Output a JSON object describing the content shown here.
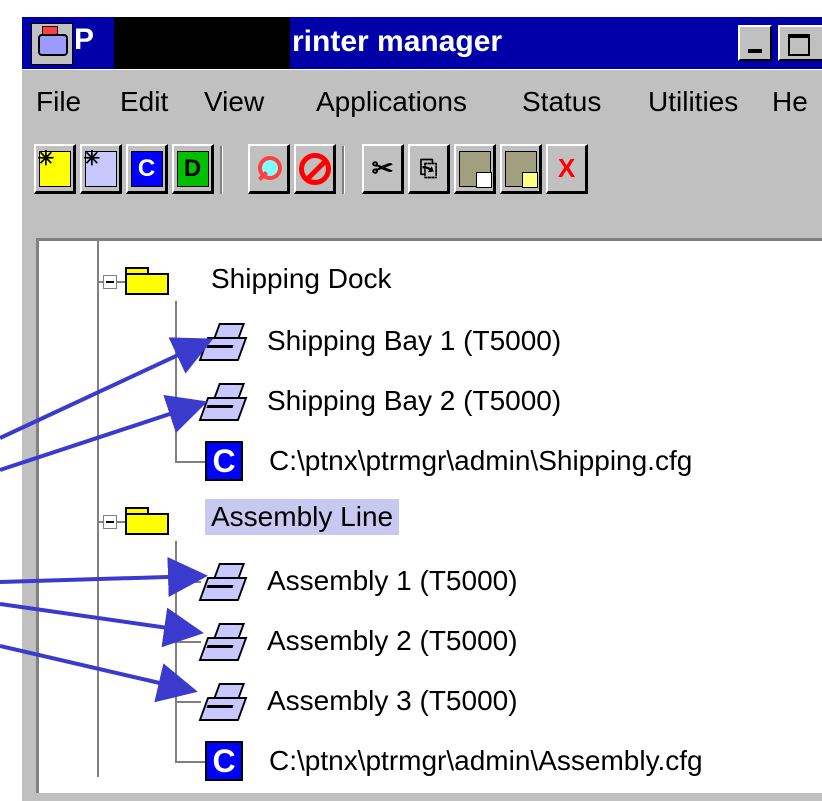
{
  "window": {
    "title_prefix": "P",
    "title": "rinter manager",
    "minimize_label": "",
    "maximize_label": ""
  },
  "menu": {
    "items": [
      "File",
      "Edit",
      "View",
      "Applications",
      "Status",
      "Utilities",
      "He"
    ]
  },
  "toolbar": {
    "buttons": [
      {
        "icon": "new-folder-icon",
        "label": ""
      },
      {
        "icon": "new-printer-icon",
        "label": ""
      },
      {
        "icon": "new-config-icon",
        "label": "C"
      },
      {
        "icon": "new-driver-icon",
        "label": "D"
      },
      {
        "icon": "search-icon",
        "label": ""
      },
      {
        "icon": "stop-icon",
        "label": ""
      },
      {
        "icon": "cut-icon",
        "label": "✂"
      },
      {
        "icon": "copy-icon",
        "label": "⎘"
      },
      {
        "icon": "paste-icon",
        "label": ""
      },
      {
        "icon": "paste-link-icon",
        "label": ""
      },
      {
        "icon": "delete-icon",
        "label": "X"
      }
    ]
  },
  "tree": {
    "groups": [
      {
        "name": "Shipping Dock",
        "selected": false,
        "children": [
          {
            "type": "printer",
            "label": "Shipping Bay 1 (T5000)"
          },
          {
            "type": "printer",
            "label": "Shipping Bay 2 (T5000)"
          },
          {
            "type": "config",
            "label": "C:\\ptnx\\ptrmgr\\admin\\Shipping.cfg"
          }
        ]
      },
      {
        "name": "Assembly Line",
        "selected": true,
        "children": [
          {
            "type": "printer",
            "label": "Assembly 1 (T5000)"
          },
          {
            "type": "printer",
            "label": "Assembly 2 (T5000)"
          },
          {
            "type": "printer",
            "label": "Assembly 3 (T5000)"
          },
          {
            "type": "config",
            "label": "C:\\ptnx\\ptrmgr\\admin\\Assembly.cfg"
          }
        ]
      }
    ],
    "config_icon_letter": "C"
  },
  "colors": {
    "titlebar": "#0000a8",
    "chrome": "#c0c0c0",
    "selection": "#c8c8f0",
    "arrow": "#3a3acc",
    "folder": "#ffff00",
    "config_icon": "#0000ff"
  }
}
